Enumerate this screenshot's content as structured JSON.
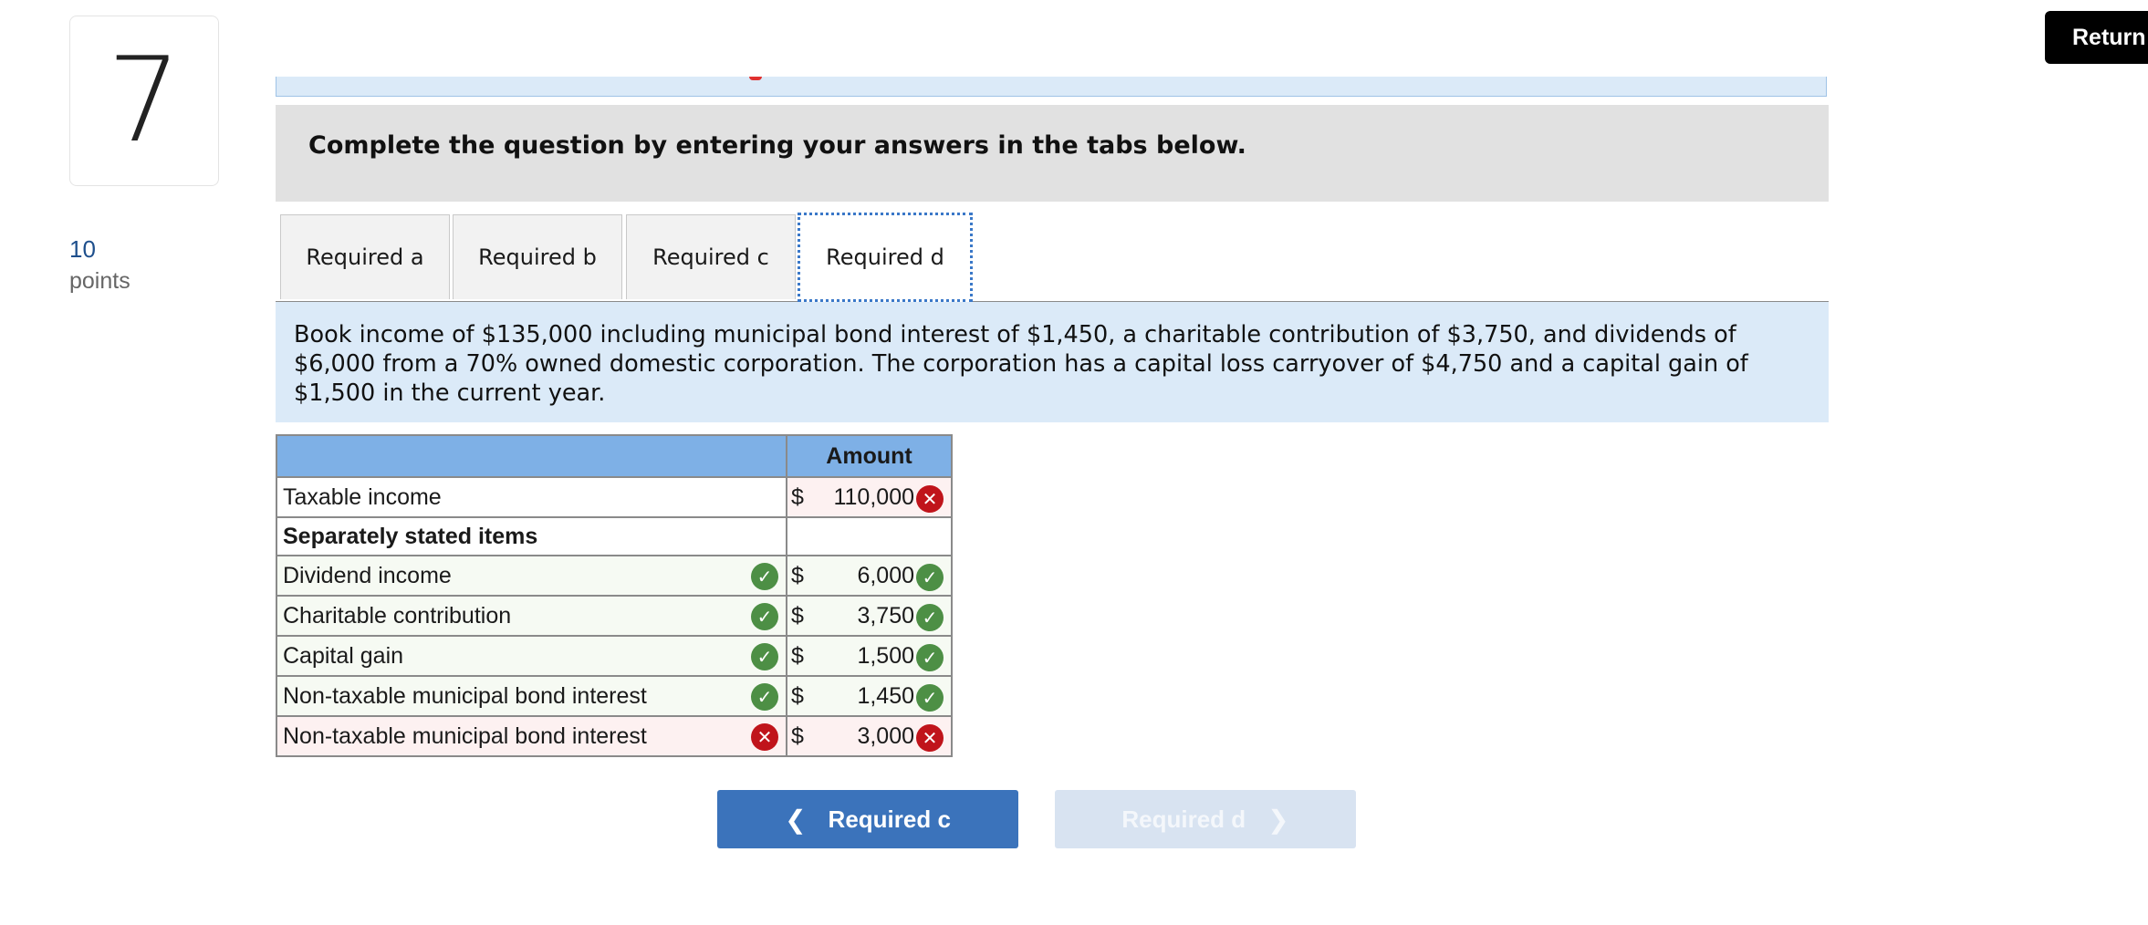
{
  "question": {
    "number": "7",
    "points_value": "10",
    "points_label": "points"
  },
  "return_button": "Return",
  "instructions": "Complete the question by entering your answers in the tabs below.",
  "tabs": [
    {
      "label": "Required a",
      "active": false
    },
    {
      "label": "Required b",
      "active": false
    },
    {
      "label": "Required c",
      "active": false
    },
    {
      "label": "Required d",
      "active": true
    }
  ],
  "description": "Book income of $135,000 including municipal bond interest of $1,450, a charitable contribution of $3,750, and dividends of $6,000 from a 70% owned domestic corporation. The corporation has a capital loss carryover of $4,750 and a capital gain of $1,500 in the current year.",
  "table": {
    "amount_header": "Amount",
    "taxable_income": {
      "label": "Taxable income",
      "currency": "$",
      "value": "110,000",
      "status": "incorrect"
    },
    "section_header": "Separately stated items",
    "rows": [
      {
        "label": "Dividend income",
        "label_status": "correct",
        "currency": "$",
        "value": "6,000",
        "status": "correct"
      },
      {
        "label": "Charitable contribution",
        "label_status": "correct",
        "currency": "$",
        "value": "3,750",
        "status": "correct"
      },
      {
        "label": "Capital gain",
        "label_status": "correct",
        "currency": "$",
        "value": "1,500",
        "status": "correct"
      },
      {
        "label": "Non-taxable municipal bond interest",
        "label_status": "correct",
        "currency": "$",
        "value": "1,450",
        "status": "correct"
      },
      {
        "label": "Non-taxable municipal bond interest",
        "label_status": "incorrect",
        "currency": "$",
        "value": "3,000",
        "status": "incorrect"
      }
    ]
  },
  "nav": {
    "prev_label": "Required c",
    "next_label": "Required d"
  },
  "colors": {
    "correct": "#4d8f45",
    "incorrect": "#c0141b",
    "header": "#7eb0e6",
    "primary": "#3b73bb"
  }
}
